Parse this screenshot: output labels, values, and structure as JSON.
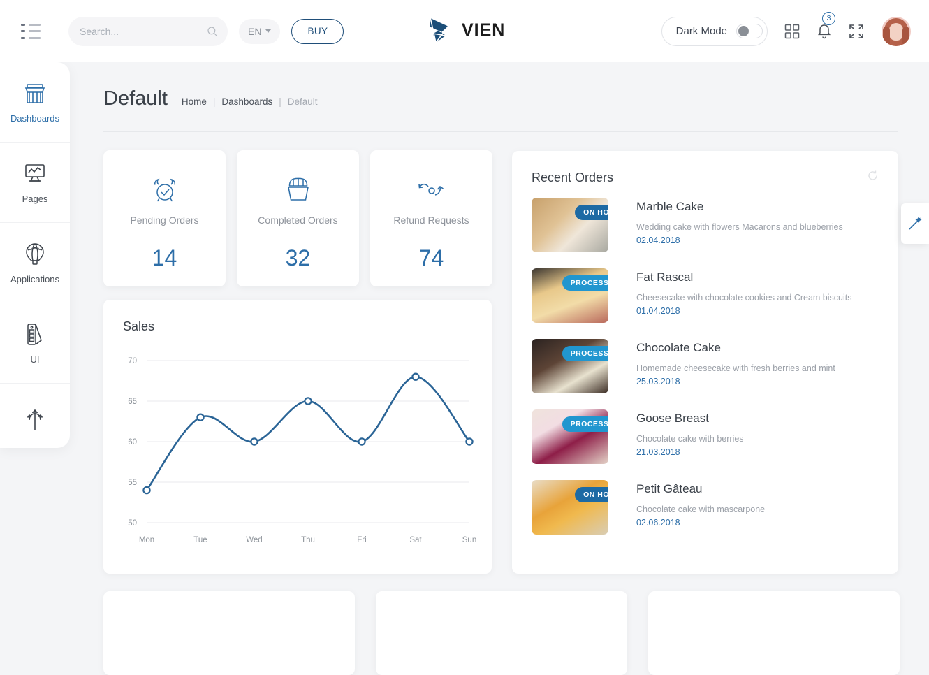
{
  "header": {
    "menu_icon": "hamburger-list-icon",
    "search": {
      "value": "",
      "placeholder": "Search...",
      "icon": "search-icon"
    },
    "language": {
      "label": "EN",
      "icon": "chevron-down-icon"
    },
    "buy_label": "BUY",
    "brand": {
      "name": "VIEN",
      "logo_icon": "vien-logo-icon"
    },
    "dark_mode": {
      "label": "Dark Mode",
      "enabled": false
    },
    "apps_icon": "grid-apps-icon",
    "notifications": {
      "icon": "bell-icon",
      "count": "3"
    },
    "fullscreen_icon": "fullscreen-expand-icon",
    "avatar": "user-avatar"
  },
  "sidebar": {
    "items": [
      {
        "label": "Dashboards",
        "icon": "store-shop-icon",
        "active": true
      },
      {
        "label": "Pages",
        "icon": "monitor-screen-icon",
        "active": false
      },
      {
        "label": "Applications",
        "icon": "hot-air-balloon-icon",
        "active": false
      },
      {
        "label": "UI",
        "icon": "palette-swatch-icon",
        "active": false
      },
      {
        "label": "",
        "icon": "trident-arrows-icon",
        "active": false
      }
    ]
  },
  "page": {
    "title": "Default",
    "breadcrumbs": [
      {
        "label": "Home",
        "muted": false
      },
      {
        "label": "Dashboards",
        "muted": false
      },
      {
        "label": "Default",
        "muted": true
      }
    ],
    "separator": "|"
  },
  "stats": [
    {
      "label": "Pending Orders",
      "value": "14",
      "icon": "alarm-clock-icon"
    },
    {
      "label": "Completed Orders",
      "value": "32",
      "icon": "basket-icon"
    },
    {
      "label": "Refund Requests",
      "value": "74",
      "icon": "refund-arrows-icon"
    }
  ],
  "chart_data": {
    "type": "line",
    "title": "Sales",
    "categories": [
      "Mon",
      "Tue",
      "Wed",
      "Thu",
      "Fri",
      "Sat",
      "Sun"
    ],
    "values": [
      54,
      63,
      60,
      65,
      60,
      68,
      60
    ],
    "yticks": [
      50,
      55,
      60,
      65,
      70
    ],
    "ylim": [
      50,
      70
    ],
    "xlabel": "",
    "ylabel": "",
    "grid": true,
    "legend": "none",
    "line_color": "#2a6496",
    "marker": "open-circle"
  },
  "orders": {
    "title": "Recent Orders",
    "refresh_icon": "refresh-circle-icon",
    "items": [
      {
        "name": "Marble Cake",
        "desc": "Wedding cake with flowers Macarons and blueberries",
        "date": "02.04.2018",
        "badge": "ON HOLD",
        "badge_color": "#1d6aa4",
        "thumb": "marble-cake-photo"
      },
      {
        "name": "Fat Rascal",
        "desc": "Cheesecake with chocolate cookies and Cream biscuits",
        "date": "01.04.2018",
        "badge": "PROCESSED",
        "badge_color": "#2196cf",
        "thumb": "pancake-stack-photo"
      },
      {
        "name": "Chocolate Cake",
        "desc": "Homemade cheesecake with fresh berries and mint",
        "date": "25.03.2018",
        "badge": "PROCESSED",
        "badge_color": "#2196cf",
        "thumb": "chocolate-cake-photo"
      },
      {
        "name": "Goose Breast",
        "desc": "Chocolate cake with berries",
        "date": "21.03.2018",
        "badge": "PROCESSED",
        "badge_color": "#2196cf",
        "thumb": "berry-cake-photo"
      },
      {
        "name": "Petit Gâteau",
        "desc": "Chocolate cake with mascarpone",
        "date": "02.06.2018",
        "badge": "ON HOLD",
        "badge_color": "#1d6aa4",
        "thumb": "petit-gateau-photo"
      }
    ]
  },
  "customizer": {
    "icon": "magic-wand-icon"
  },
  "colors": {
    "accent": "#2d6ea8",
    "brand_dark": "#1f4e79",
    "page_bg": "#f4f5f7",
    "card_bg": "#ffffff",
    "muted_text": "#9ba0a8"
  }
}
